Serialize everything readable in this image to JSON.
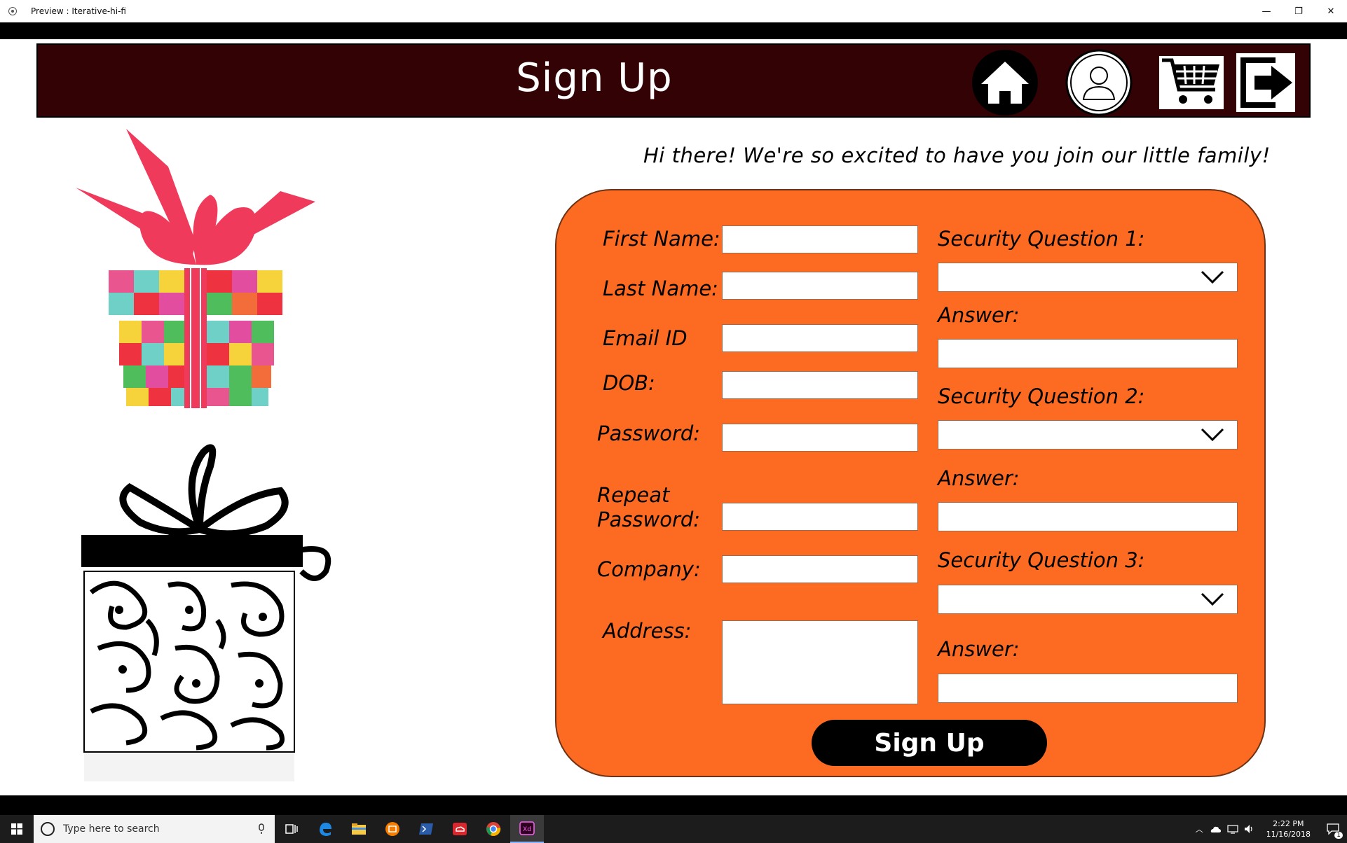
{
  "window": {
    "title": "Preview : Iterative-hi-fi",
    "controls": {
      "minimize": "—",
      "restore": "❐",
      "close": "✕"
    }
  },
  "header": {
    "title": "Sign Up"
  },
  "greeting": "Hi there! We're so excited to have you join our little family!",
  "form": {
    "left_fields": [
      {
        "label": "First Name:",
        "value": ""
      },
      {
        "label": "Last Name:",
        "value": ""
      },
      {
        "label": "Email ID",
        "value": ""
      },
      {
        "label": "DOB:",
        "value": ""
      },
      {
        "label": "Password:",
        "value": ""
      },
      {
        "label_line1": "Repeat",
        "label_line2": "Password:",
        "value": ""
      },
      {
        "label": "Company:",
        "value": ""
      },
      {
        "label": "Address:",
        "value": ""
      }
    ],
    "security": [
      {
        "question_label": "Security Question 1:",
        "selected": "",
        "answer_label": "Answer:",
        "answer": ""
      },
      {
        "question_label": "Security Question 2:",
        "selected": "",
        "answer_label": "Answer:",
        "answer": ""
      },
      {
        "question_label": "Security Question 3:",
        "selected": "",
        "answer_label": "Answer:",
        "answer": ""
      }
    ],
    "submit_label": "Sign Up"
  },
  "nav": {
    "icons": [
      "home-icon",
      "profile-icon",
      "cart-icon",
      "logout-icon"
    ]
  },
  "taskbar": {
    "search_placeholder": "Type here to search",
    "time": "2:22 PM",
    "date": "11/16/2018",
    "notification_count": "1"
  },
  "colors": {
    "header_bg": "#330204",
    "panel": "#fd6a22",
    "button": "#000000"
  }
}
